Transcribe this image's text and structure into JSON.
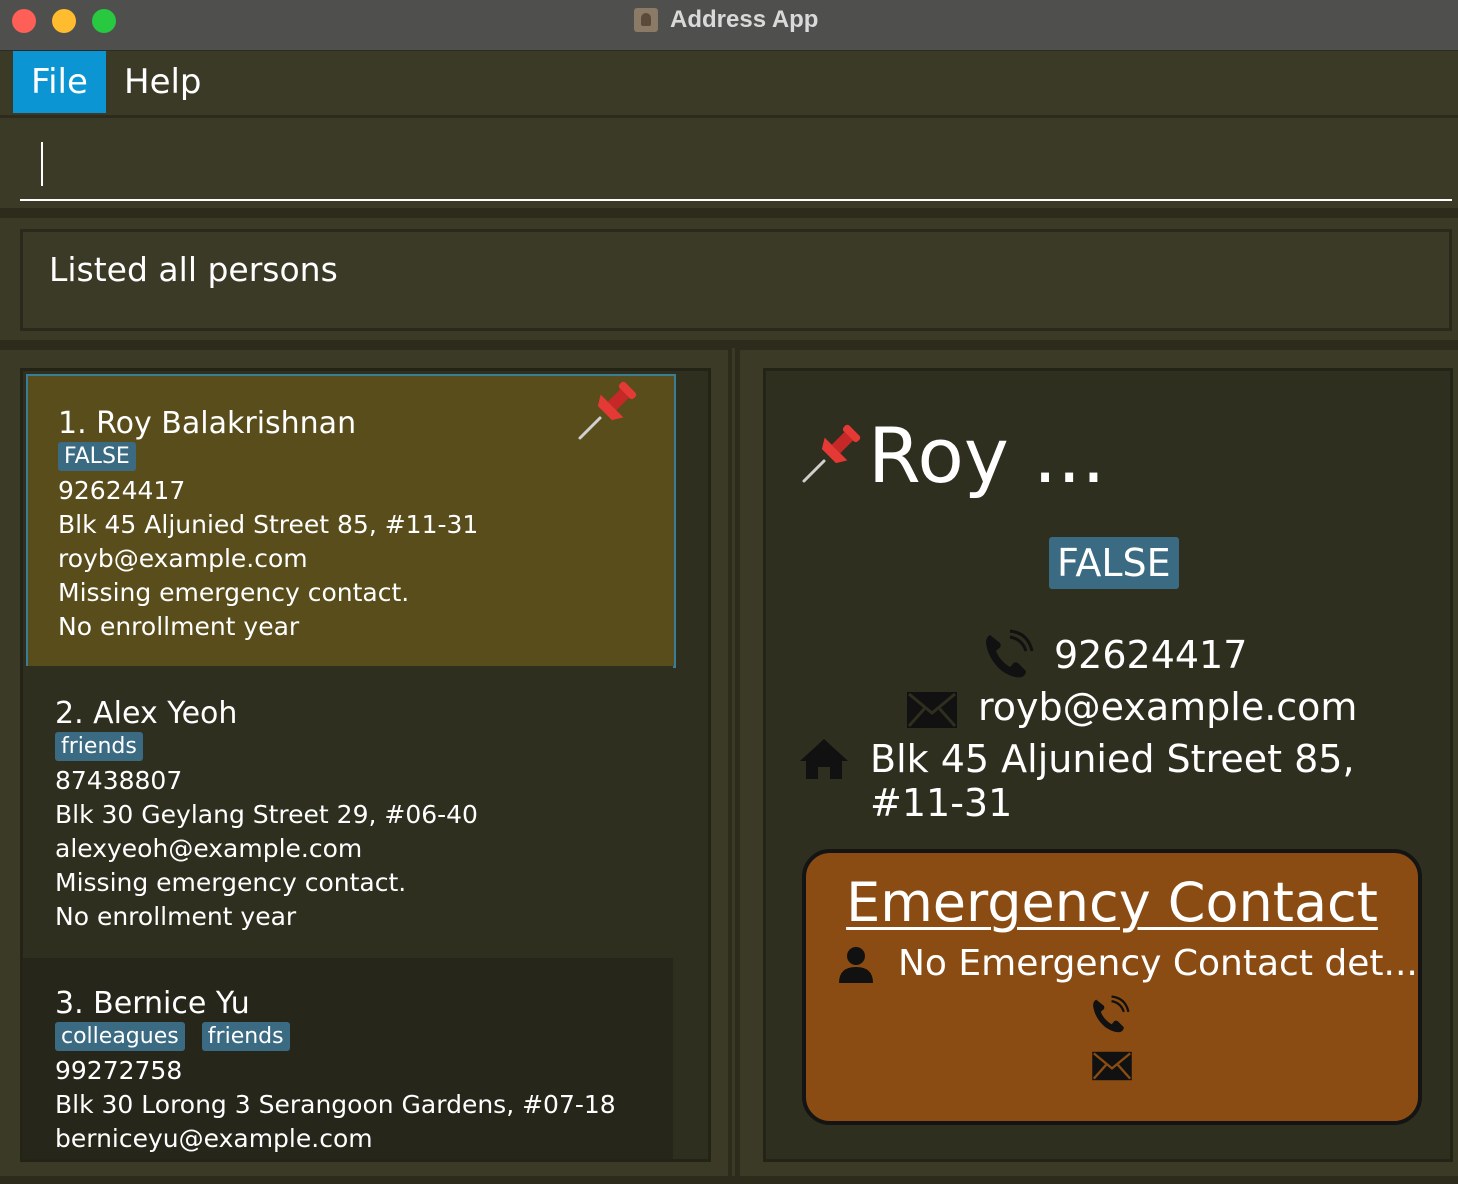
{
  "window": {
    "title": "Address App"
  },
  "menu": {
    "file": "File",
    "help": "Help"
  },
  "command": {
    "value": ""
  },
  "result": {
    "text": "Listed all persons"
  },
  "persons": [
    {
      "name": "1. Roy Balakrishnan",
      "tags": [
        "FALSE"
      ],
      "phone": "92624417",
      "address": "Blk 45 Aljunied Street 85, #11-31",
      "email": "royb@example.com",
      "emergency": "Missing emergency contact.",
      "enrollment": "No enrollment year",
      "pinned": true
    },
    {
      "name": "2. Alex Yeoh",
      "tags": [
        "friends"
      ],
      "phone": "87438807",
      "address": "Blk 30 Geylang Street 29, #06-40",
      "email": "alexyeoh@example.com",
      "emergency": "Missing emergency contact.",
      "enrollment": "No enrollment year",
      "pinned": false
    },
    {
      "name": "3. Bernice Yu",
      "tags": [
        "colleagues",
        "friends"
      ],
      "phone": "99272758",
      "address": "Blk 30 Lorong 3 Serangoon Gardens, #07-18",
      "email": "berniceyu@example.com",
      "pinned": false
    }
  ],
  "detail": {
    "name": "Roy ...",
    "tag": "FALSE",
    "phone": "92624417",
    "email": "royb@example.com",
    "address": "Blk 45 Aljunied Street 85, #11-31",
    "emergency_title": "Emergency Contact",
    "emergency_name": "No Emergency Contact det..."
  },
  "icons": {
    "pin": "pushpin-icon",
    "phone": "phone-icon",
    "email": "envelope-icon",
    "home": "house-icon",
    "person": "person-icon"
  },
  "colors": {
    "selected_card": "#5a4d1c",
    "tag": "#3a6b82",
    "emergency_box": "#8b4c13",
    "menu_active": "#0b96d3"
  }
}
